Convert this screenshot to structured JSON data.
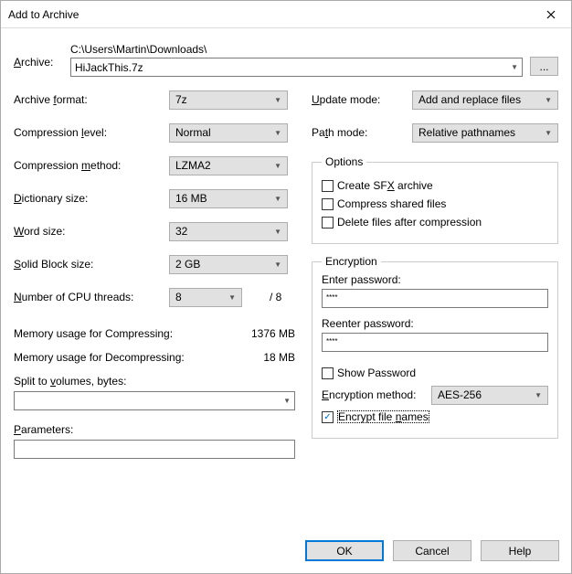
{
  "titlebar": {
    "title": "Add to Archive"
  },
  "archive": {
    "label": "Archive:",
    "path": "C:\\Users\\Martin\\Downloads\\",
    "filename": "HiJackThis.7z",
    "browse": "..."
  },
  "left": {
    "format": {
      "label_pre": "Archive ",
      "label_ul": "f",
      "label_post": "ormat:",
      "value": "7z"
    },
    "level": {
      "label_pre": "Compression ",
      "label_ul": "l",
      "label_post": "evel:",
      "value": "Normal"
    },
    "method": {
      "label_pre": "Compression ",
      "label_ul": "m",
      "label_post": "ethod:",
      "value": "LZMA2"
    },
    "dictionary": {
      "label_pre": "",
      "label_ul": "D",
      "label_post": "ictionary size:",
      "value": "16 MB"
    },
    "word": {
      "label_pre": "",
      "label_ul": "W",
      "label_post": "ord size:",
      "value": "32"
    },
    "block": {
      "label_pre": "",
      "label_ul": "S",
      "label_post": "olid Block size:",
      "value": "2 GB"
    },
    "threads": {
      "label_pre": "",
      "label_ul": "N",
      "label_post": "umber of CPU threads:",
      "value": "8",
      "max": "/ 8"
    },
    "mem_compress": {
      "label": "Memory usage for Compressing:",
      "value": "1376 MB"
    },
    "mem_decompress": {
      "label": "Memory usage for Decompressing:",
      "value": "18 MB"
    },
    "split": {
      "label_pre": "Split to ",
      "label_ul": "v",
      "label_post": "olumes, bytes:",
      "value": ""
    },
    "params": {
      "label_pre": "",
      "label_ul": "P",
      "label_post": "arameters:",
      "value": ""
    }
  },
  "right": {
    "update": {
      "label_pre": "",
      "label_ul": "U",
      "label_post": "pdate mode:",
      "value": "Add and replace files"
    },
    "path": {
      "label_pre": "Pa",
      "label_ul": "t",
      "label_post": "h mode:",
      "value": "Relative pathnames"
    },
    "options": {
      "legend": "Options",
      "sfx": {
        "label_pre": "Create SF",
        "label_ul": "X",
        "label_post": " archive",
        "checked": false
      },
      "shared": {
        "label": "Compress shared files",
        "checked": false
      },
      "delete": {
        "label": "Delete files after compression",
        "checked": false
      }
    },
    "encryption": {
      "legend": "Encryption",
      "enter": {
        "label": "Enter password:",
        "value": "****"
      },
      "reenter": {
        "label": "Reenter password:",
        "value": "****"
      },
      "show": {
        "label": "Show Password",
        "checked": false
      },
      "method": {
        "label_pre": "",
        "label_ul": "E",
        "label_post": "ncryption method:",
        "value": "AES-256"
      },
      "names": {
        "label_pre": "Encrypt file ",
        "label_ul": "n",
        "label_post": "ames",
        "checked": true
      }
    }
  },
  "buttons": {
    "ok": "OK",
    "cancel": "Cancel",
    "help": "Help"
  }
}
